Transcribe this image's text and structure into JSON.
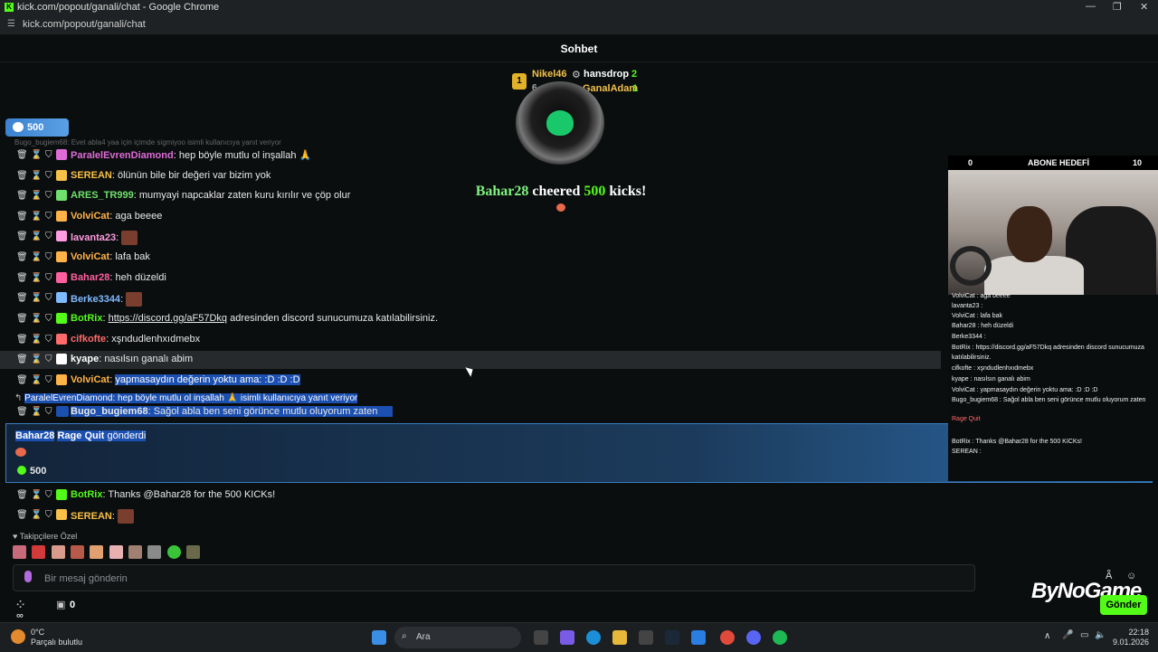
{
  "window": {
    "title": "kick.com/popout/ganali/chat - Google Chrome",
    "url": "kick.com/popout/ganali/chat"
  },
  "header": {
    "title": "Sohbet"
  },
  "leaderboard": {
    "first": {
      "rank": "1",
      "name": "Nikel46"
    },
    "second": {
      "name": "hansdrop",
      "count": "2"
    },
    "third_partial": "6",
    "fourth": {
      "name": "GanalAdam",
      "count": "1"
    }
  },
  "kicks_pill": {
    "value": "500"
  },
  "cut_line": "Bugo_bugiem68: Evet abla4 yaa için içimde sigmiyoo isimli kullanıcıya yanıt veriyor",
  "messages": [
    {
      "name": "ParalelEvrenDiamond",
      "color": "#e06bd8",
      "text": "hep böyle mutlu ol inşallah 🙏"
    },
    {
      "name": "SEREAN",
      "color": "#f7c046",
      "text": "ölünün bile bir değeri var bizim yok"
    },
    {
      "name": "ARES_TR999",
      "color": "#6ee06b",
      "text": "mumyayi napcaklar zaten kuru kırılır ve çöp olur"
    },
    {
      "name": "VolviCat",
      "color": "#ffb347",
      "text": "aga beeee"
    },
    {
      "name": "lavanta23",
      "color": "#ff9be0",
      "text": ""
    },
    {
      "name": "VolviCat",
      "color": "#ffb347",
      "text": "lafa bak"
    },
    {
      "name": "Bahar28",
      "color": "#ff5f9e",
      "text": "heh düzeldi"
    },
    {
      "name": "Berke3344",
      "color": "#7fb9ff",
      "text": ""
    },
    {
      "name": "BotRix",
      "color": "#53fc18",
      "link": "https://discord.gg/aF57Dkq",
      "text": "adresinden discord sunucumuza katılabilirsiniz."
    },
    {
      "name": "cifkofte",
      "color": "#ff6b6b",
      "text": "xşndudlenhxıdmebx"
    },
    {
      "name": "kyape",
      "color": "#ffffff",
      "text": "nasılsın ganalı abim"
    },
    {
      "name": "VolviCat",
      "color": "#ffb347",
      "text": "yapmasaydın değerin yoktu ama: :D :D :D"
    }
  ],
  "reply_context": {
    "text": "ParalelEvrenDiamond: hep böyle mutlu ol inşallah 🙏 isimli kullanıcıya yanıt veriyor"
  },
  "reply_message": {
    "name": "Bugo_bugiem68",
    "color": "#ffffff",
    "text": "Sağol abla ben seni görünce mutlu oluyorum zaten"
  },
  "cheer": {
    "user": "Bahar28",
    "word": "cheered",
    "amount": "500",
    "unit": "kicks!"
  },
  "gift": {
    "user": "Bahar28",
    "item": "Rage Quit",
    "action": "gönderdi",
    "amount": "500"
  },
  "after_messages": [
    {
      "name": "BotRix",
      "color": "#53fc18",
      "text": "Thanks @Bahar28 for the 500 KICKs!"
    },
    {
      "name": "SEREAN",
      "color": "#f7c046",
      "text": ""
    }
  ],
  "followers_label": "Takipçilere Özel",
  "chat_input": {
    "placeholder": "Bir mesaj gönderin"
  },
  "bottom": {
    "left_value": "0"
  },
  "send_label": "Gönder",
  "stream_overlay": {
    "goal_left": "0",
    "goal_title": "ABONE HEDEFİ",
    "goal_right": "10",
    "lines": [
      "VolviCat : aga beeee",
      "lavanta23 :",
      "VolviCat : lafa bak",
      "Bahar28 : heh düzeldi",
      "Berke3344 :",
      "BotRix : https://discord.gg/aF57Dkq adresinden discord sunucumuza",
      "katılabilirsiniz.",
      "cifkofte : xşndudlenhxıdmebx",
      "kyape : nasılsın ganalı abim",
      "VolviCat : yapmasaydın değerin yoktu ama: :D :D :D",
      "Bugo_bugiem68 : Sağol abla ben seni görünce mutlu oluyorum zaten",
      "Rage Quit",
      "BotRix : Thanks @Bahar28 for the 500 KICKs!",
      "SEREAN :"
    ],
    "brand": "ByNoGame"
  },
  "taskbar": {
    "temp": "0°C",
    "weather": "Parçalı bulutlu",
    "search": "Ara",
    "time": "22:18",
    "date": "9.01.2026"
  }
}
